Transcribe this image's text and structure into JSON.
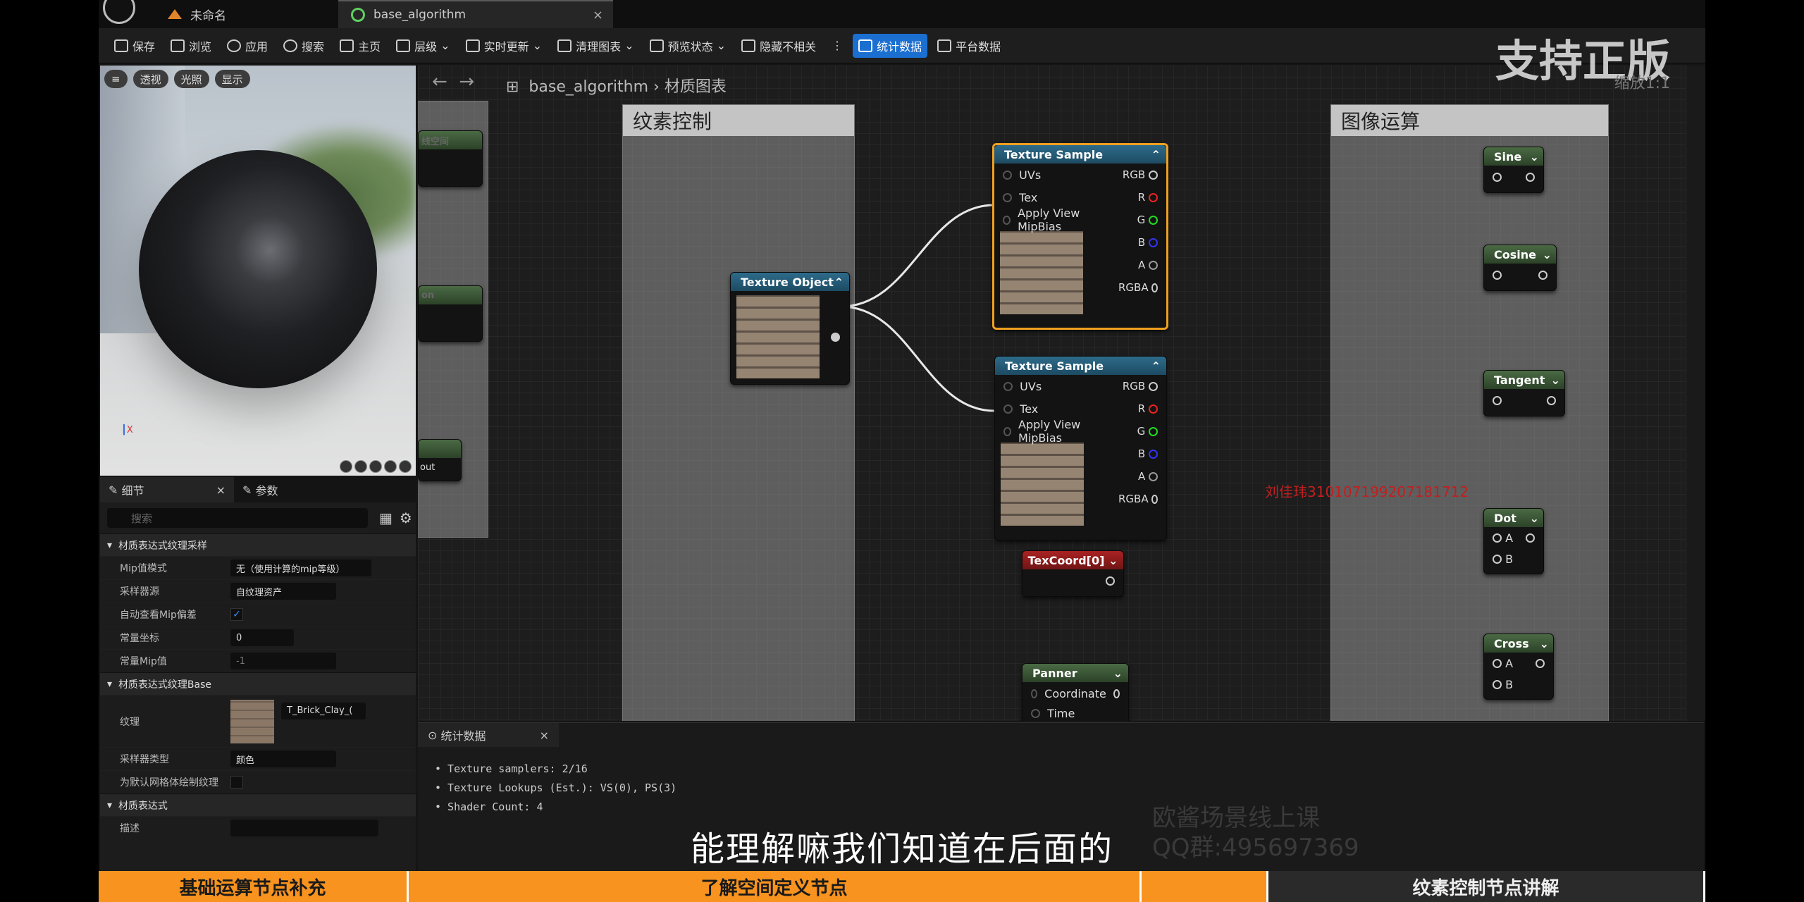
{
  "tabs": {
    "untitled": "未命名",
    "active": "base_algorithm",
    "close": "×"
  },
  "toolbar": {
    "save": "保存",
    "browse": "浏览",
    "apply": "应用",
    "search": "搜索",
    "home": "主页",
    "hierarchy": "层级",
    "live_update": "实时更新",
    "clean_graph": "清理图表",
    "preview_state": "预览状态",
    "hide_unrelated": "隐藏不相关",
    "more": "⋮",
    "stats": "统计数据",
    "platform": "平台数据"
  },
  "overlay": {
    "big_watermark": "支持正版",
    "zoom": "缩放1:1",
    "material": "材质",
    "red_watermark": "刘佳玮310107199207181712",
    "course": "欧酱场景线上课",
    "qq": "QQ群:495697369"
  },
  "viewport": {
    "buttons": [
      "透视",
      "光照",
      "显示"
    ],
    "axis_x": "X"
  },
  "details": {
    "tab_details": "细节",
    "tab_params": "参数",
    "close": "×",
    "search_placeholder": "搜索",
    "section1": "材质表达式纹理采样",
    "mip_mode_label": "Mip值模式",
    "mip_mode_value": "无（使用计算的mip等级）",
    "sampler_source_label": "采样器源",
    "sampler_source_value": "自纹理资产",
    "auto_mip_label": "自动查看Mip偏差",
    "auto_mip_value": "✓",
    "const_coord_label": "常量坐标",
    "const_coord_value": "0",
    "const_mip_label": "常量Mip值",
    "const_mip_value": "-1",
    "section2": "材质表达式纹理Base",
    "texture_label": "纹理",
    "texture_value": "T_Brick_Clay_(",
    "sampler_type_label": "采样器类型",
    "sampler_type_value": "颜色",
    "default_mesh_label": "为默认网格体绘制纹理",
    "section3": "材质表达式",
    "desc_label": "描述"
  },
  "graph": {
    "breadcrumb_root": "base_algorithm",
    "breadcrumb_sep": "›",
    "breadcrumb_child": "材质图表",
    "comment_texture": "纹素控制",
    "comment_image": "图像运算",
    "left_partial": [
      "线空间",
      "on",
      "量空间",
      "out"
    ],
    "texture_object": "Texture Object",
    "texture_sample": "Texture Sample",
    "pins_in": [
      "UVs",
      "Tex",
      "Apply View MipBias"
    ],
    "pins_out": [
      "RGB",
      "R",
      "G",
      "B",
      "A",
      "RGBA"
    ],
    "texcoord": "TexCoord[0]",
    "panner": "Panner",
    "panner_pins": [
      "Coordinate",
      "Time"
    ],
    "sine": "Sine",
    "cosine": "Cosine",
    "tangent": "Tangent",
    "dot": "Dot",
    "cross": "Cross",
    "pinA": "A",
    "pinB": "B"
  },
  "stats": {
    "tab": "统计数据",
    "close": "×",
    "lines": [
      "• Texture samplers: 2/16",
      "• Texture Lookups (Est.): VS(0), PS(3)",
      "• Shader Count: 4"
    ]
  },
  "subtitle": "能理解嘛我们知道在后面的",
  "chapters": [
    "基础运算节点补充",
    "了解空间定义节点",
    "",
    "纹素控制节点讲解"
  ]
}
